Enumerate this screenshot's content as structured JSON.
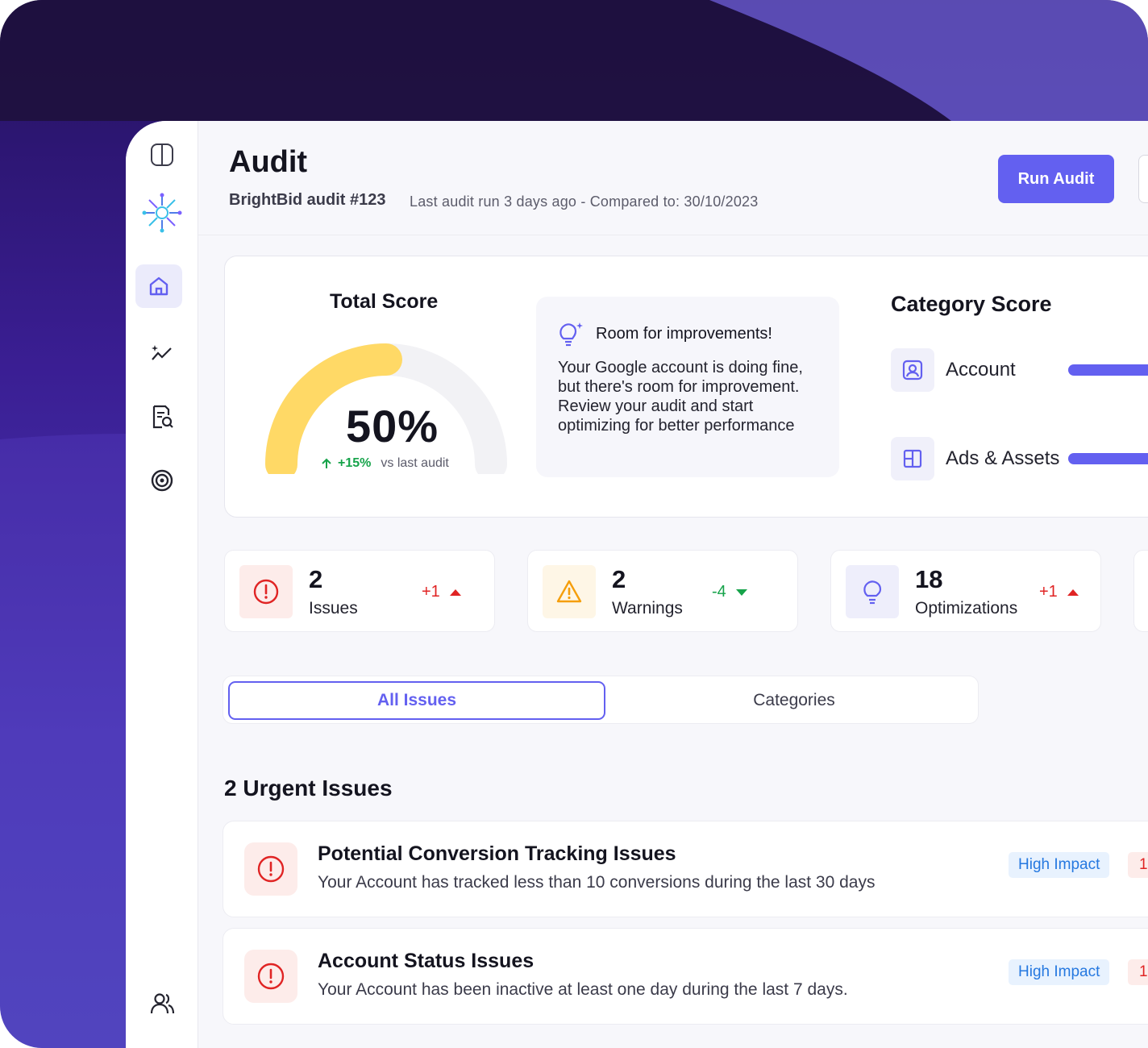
{
  "header": {
    "title": "Audit",
    "subtitle": "BrightBid audit #123",
    "meta": "Last audit run 3 days ago - Compared to: 30/10/2023",
    "run_button": "Run Audit"
  },
  "sidebar": {
    "items": [
      {
        "icon": "sidebar-toggle-icon"
      },
      {
        "icon": "brightbid-logo"
      },
      {
        "icon": "home-icon",
        "active": true
      },
      {
        "icon": "analytics-sparkle-icon"
      },
      {
        "icon": "report-search-icon"
      },
      {
        "icon": "target-icon"
      },
      {
        "icon": "users-icon"
      }
    ]
  },
  "score": {
    "label": "Total Score",
    "value": "50%",
    "progress": 0.5,
    "delta": "+15%",
    "delta_text": "vs last audit",
    "gauge_color": "#ffd966"
  },
  "tip": {
    "title": "Room for improvements!",
    "body": "Your Google account is doing fine, but there's room for improvement. Review your audit and start optimizing for better performance"
  },
  "category": {
    "title": "Category Score",
    "items": [
      {
        "label": "Account",
        "icon": "account-icon"
      },
      {
        "label": "Ads & Assets",
        "icon": "layout-icon"
      }
    ]
  },
  "stats": [
    {
      "num": "2",
      "label": "Issues",
      "delta": "+1",
      "direction": "up",
      "delta_color": "#e02424"
    },
    {
      "num": "2",
      "label": "Warnings",
      "delta": "-4",
      "direction": "down",
      "delta_color": "#16a34a"
    },
    {
      "num": "18",
      "label": "Optimizations",
      "delta": "+1",
      "direction": "up",
      "delta_color": "#e02424"
    }
  ],
  "tabs": {
    "all": "All Issues",
    "categories": "Categories"
  },
  "urgent": {
    "title": "2 Urgent Issues",
    "items": [
      {
        "title": "Potential Conversion Tracking Issues",
        "desc": "Your Account has tracked less than 10 conversions during the last 30 days",
        "badge": "High Impact",
        "count": "1"
      },
      {
        "title": "Account Status Issues",
        "desc": "Your Account has been inactive at least one day during the last 7 days.",
        "badge": "High Impact",
        "count": "1"
      }
    ]
  },
  "colors": {
    "accent": "#6360f0",
    "danger": "#e02424",
    "warning": "#f59e0b",
    "success": "#16a34a"
  }
}
